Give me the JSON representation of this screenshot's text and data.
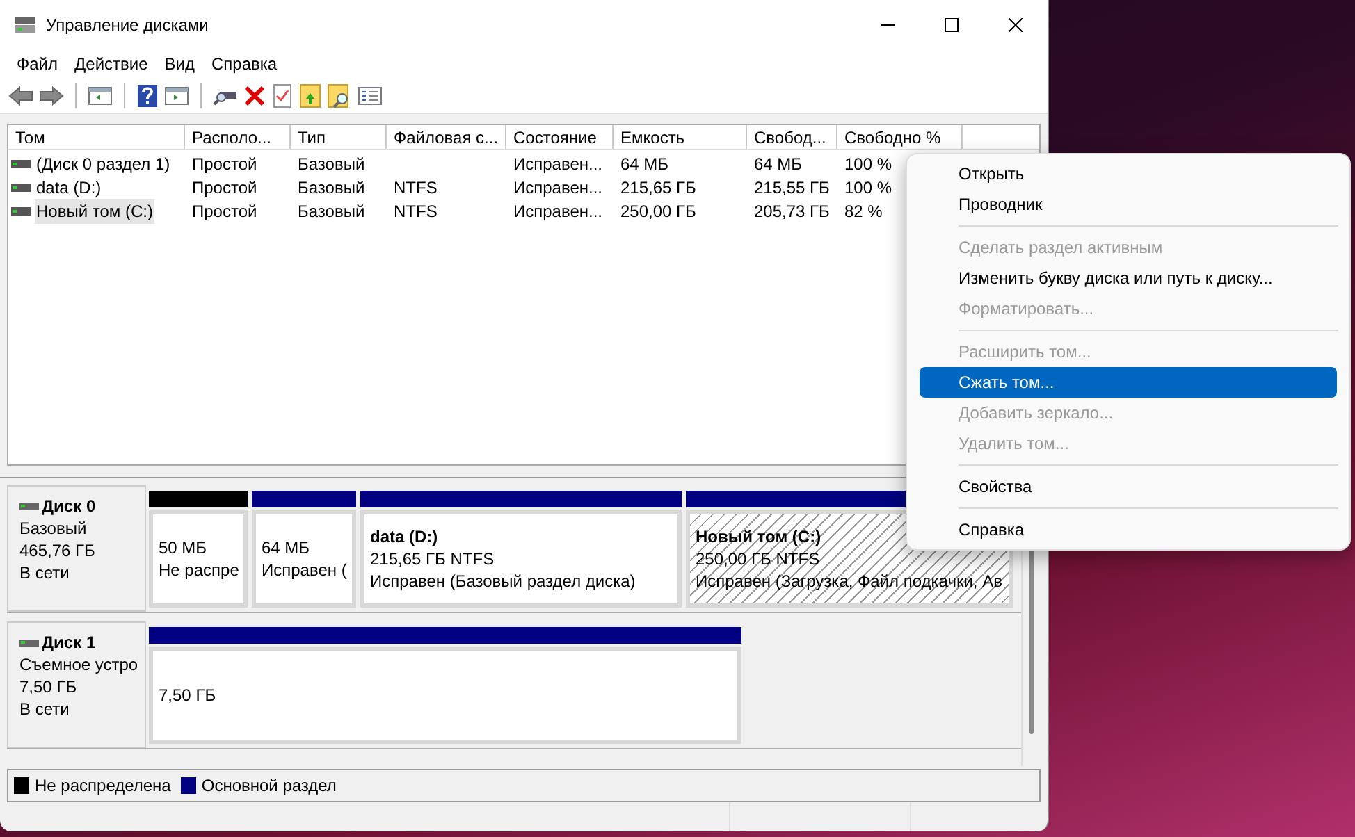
{
  "window": {
    "title": "Управление дисками"
  },
  "menu_bar": [
    "Файл",
    "Действие",
    "Вид",
    "Справка"
  ],
  "volume_table": {
    "columns": [
      "Том",
      "Располо...",
      "Тип",
      "Файловая с...",
      "Состояние",
      "Емкость",
      "Свобод...",
      "Свободно %"
    ],
    "rows": [
      {
        "selected": false,
        "cells": [
          "(Диск 0 раздел 1)",
          "Простой",
          "Базовый",
          null,
          "Исправен...",
          "64 МБ",
          "64 МБ",
          "100 %"
        ]
      },
      {
        "selected": false,
        "cells": [
          "data (D:)",
          "Простой",
          "Базовый",
          "NTFS",
          "Исправен...",
          "215,65 ГБ",
          "215,55 ГБ",
          "100 %"
        ]
      },
      {
        "selected": true,
        "cells": [
          "Новый том (C:)",
          "Простой",
          "Базовый",
          "NTFS",
          "Исправен...",
          "250,00 ГБ",
          "205,73 ГБ",
          "82 %"
        ]
      }
    ]
  },
  "disks": [
    {
      "name": "Диск 0",
      "type": "Базовый",
      "size": "465,76 ГБ",
      "status": "В сети",
      "partitions": [
        {
          "kind": "unallocated",
          "selected": false,
          "lines": [
            "50 МБ",
            "Не распре"
          ]
        },
        {
          "kind": "primary",
          "selected": false,
          "lines": [
            "64 МБ",
            "Исправен ("
          ]
        },
        {
          "kind": "primary",
          "selected": false,
          "title": "data  (D:)",
          "lines": [
            "215,65 ГБ NTFS",
            "Исправен (Базовый раздел диска)"
          ]
        },
        {
          "kind": "primary",
          "selected": true,
          "title": "Новый том  (C:)",
          "lines": [
            "250,00 ГБ NTFS",
            "Исправен (Загрузка, Файл подкачки, Ав"
          ]
        }
      ]
    },
    {
      "name": "Диск 1",
      "type": "Съемное устро",
      "size": "7,50 ГБ",
      "status": "В сети",
      "partitions": [
        {
          "kind": "primary",
          "selected": false,
          "lines": [
            "7,50 ГБ"
          ]
        }
      ]
    }
  ],
  "legend": [
    {
      "label": "Не распределена",
      "color": "#000000"
    },
    {
      "label": "Основной раздел",
      "color": "#000080"
    }
  ],
  "context_menu": {
    "groups": [
      [
        {
          "label": "Открыть",
          "disabled": false,
          "selected": false
        },
        {
          "label": "Проводник",
          "disabled": false,
          "selected": false
        }
      ],
      [
        {
          "label": "Сделать раздел активным",
          "disabled": true,
          "selected": false
        },
        {
          "label": "Изменить букву диска или путь к диску...",
          "disabled": false,
          "selected": false
        },
        {
          "label": "Форматировать...",
          "disabled": true,
          "selected": false
        }
      ],
      [
        {
          "label": "Расширить том...",
          "disabled": true,
          "selected": false
        },
        {
          "label": "Сжать том...",
          "disabled": false,
          "selected": true
        },
        {
          "label": "Добавить зеркало...",
          "disabled": true,
          "selected": false
        },
        {
          "label": "Удалить том...",
          "disabled": true,
          "selected": false
        }
      ],
      [
        {
          "label": "Свойства",
          "disabled": false,
          "selected": false
        }
      ],
      [
        {
          "label": "Справка",
          "disabled": false,
          "selected": false
        }
      ]
    ]
  }
}
